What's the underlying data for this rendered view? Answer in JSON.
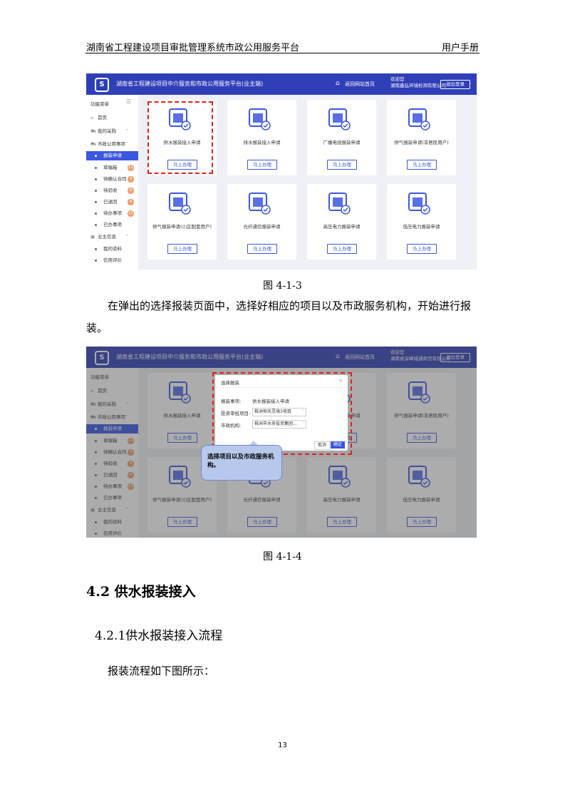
{
  "header": {
    "title": "湖南省工程建设项目审批管理系统市政公用服务平台",
    "manual": "用户手册"
  },
  "app": {
    "title": "湖南省工程建设项目中介服务和市政公用服务平台(业主端)",
    "home_link": "返回网站首页",
    "welcome": "欢迎您",
    "logout": "退出登录"
  },
  "shot1": {
    "company": "湖南鑫弘环境检测有限公司"
  },
  "shot2": {
    "company": "湖南省深峰城通商贸有限公司"
  },
  "sidebar": {
    "title": "功能菜单",
    "home": "首页",
    "purchase": "我的采购",
    "municipal": "市政公用事项",
    "apply": "报装申请",
    "draft": "草稿箱",
    "draft_count": "11",
    "confirm_contract": "待确认合同",
    "confirm_count": "3",
    "to_accept": "待验收",
    "accept_count": "4",
    "returned": "已退回",
    "returned_count": "4",
    "todo": "待办事项",
    "todo_count": "10",
    "done": "已办事项",
    "owner_info": "业主信息",
    "my_info": "我的资料",
    "credit": "信用评价"
  },
  "services": [
    {
      "label": "供水报装接入申请",
      "icon": "water-supply-icon"
    },
    {
      "label": "排水报装接入申请",
      "icon": "drainage-icon"
    },
    {
      "label": "广播电视报装申请",
      "icon": "broadcast-tv-icon"
    },
    {
      "label": "供气报装申请(非居民用户)",
      "icon": "gas-icon"
    },
    {
      "label": "供气报装申请(小区配套用户)",
      "icon": "gas-community-icon"
    },
    {
      "label": "光纤通信报装申请",
      "icon": "fiber-icon"
    },
    {
      "label": "高压电力报装申请",
      "icon": "high-voltage-icon"
    },
    {
      "label": "低压电力报装申请",
      "icon": "low-voltage-icon"
    }
  ],
  "go_button": "马上办理",
  "dialog": {
    "title": "选择报装",
    "item_label": "报装事项:",
    "item_value": "供水报装接入申请",
    "project_label": "投资审批项目:",
    "project_value": "株洲恒天灵境3项目",
    "org_label": "市政机构:",
    "org_value": "株洲市水务投资集团...",
    "cancel": "取消",
    "ok": "确定"
  },
  "callout": "选择项目以及市政服务机构。",
  "captions": {
    "fig1": "图 4-1-3",
    "fig2": "图 4-1-4"
  },
  "paragraph1": "在弹出的选择报装页面中，选择好相应的项目以及市政服务机构，开始进行报装。",
  "section_heading": "4.2 供水报装接入",
  "subsection_heading": "4.2.1供水报装接入流程",
  "paragraph2": "报装流程如下图所示：",
  "page_number": "13",
  "colors": {
    "brand": "#2f3fb8",
    "accent": "#3b56e0",
    "highlight": "#e0201c",
    "badge": "#f0a070"
  }
}
